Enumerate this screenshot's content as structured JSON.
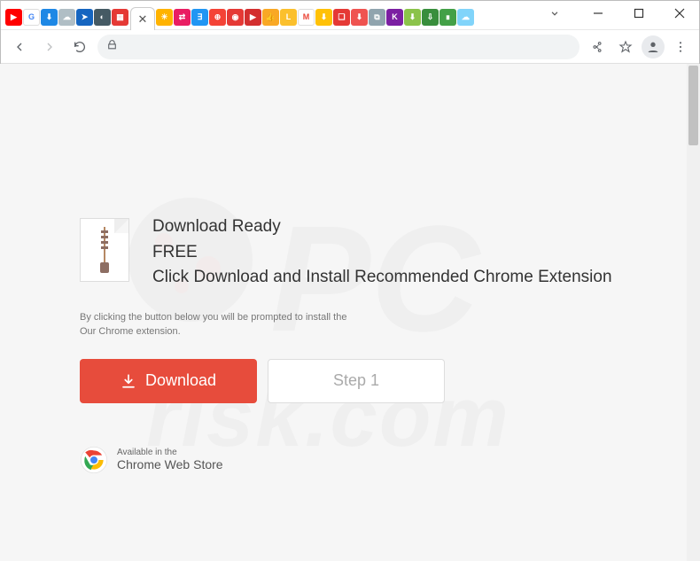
{
  "window": {
    "chevron": "⌄"
  },
  "tabs": {
    "items": [
      {
        "bg": "#ff0000",
        "txt": "▶"
      },
      {
        "bg": "#ffffff",
        "txt": "G",
        "fg": "#4285f4"
      },
      {
        "bg": "#1e88e5",
        "txt": "⬇"
      },
      {
        "bg": "#b0bec5",
        "txt": "☁"
      },
      {
        "bg": "#1565c0",
        "txt": "➤"
      },
      {
        "bg": "#455a64",
        "txt": "◐"
      },
      {
        "bg": "#e53935",
        "txt": "▦"
      },
      {
        "bg": "#ff9800",
        "txt": "▣"
      },
      {
        "bg": "#ffb300",
        "txt": "☀"
      },
      {
        "bg": "#e91e63",
        "txt": "⇄"
      },
      {
        "bg": "#2196f3",
        "txt": "∃"
      },
      {
        "bg": "#f44336",
        "txt": "⊕"
      },
      {
        "bg": "#e53935",
        "txt": "◉"
      },
      {
        "bg": "#d32f2f",
        "txt": "▶"
      },
      {
        "bg": "#f9a825",
        "txt": "👍"
      },
      {
        "bg": "#fbc02d",
        "txt": "L"
      },
      {
        "bg": "#ffffff",
        "txt": "M",
        "fg": "#ea4335"
      },
      {
        "bg": "#ffc107",
        "txt": "⬇"
      },
      {
        "bg": "#e53935",
        "txt": "❏"
      },
      {
        "bg": "#ef5350",
        "txt": "⬇"
      },
      {
        "bg": "#90a4ae",
        "txt": "⧉"
      },
      {
        "bg": "#7b1fa2",
        "txt": "K"
      },
      {
        "bg": "#8bc34a",
        "txt": "⬇"
      },
      {
        "bg": "#388e3c",
        "txt": "⇩"
      },
      {
        "bg": "#43a047",
        "txt": "∎"
      },
      {
        "bg": "#81d4fa",
        "txt": "☁"
      }
    ],
    "close": "✕"
  },
  "page": {
    "heading1": "Download Ready",
    "heading2": "FREE",
    "heading3": "Click Download and Install Recommended Chrome Extension",
    "disclaimer1": "By clicking the button below you will be prompted to install the",
    "disclaimer2": "Our Chrome extension.",
    "download_label": "Download",
    "step_label": "Step 1",
    "webstore_line1": "Available in the",
    "webstore_line2": "Chrome Web Store"
  },
  "watermark": {
    "text": "PCrisk.com"
  }
}
